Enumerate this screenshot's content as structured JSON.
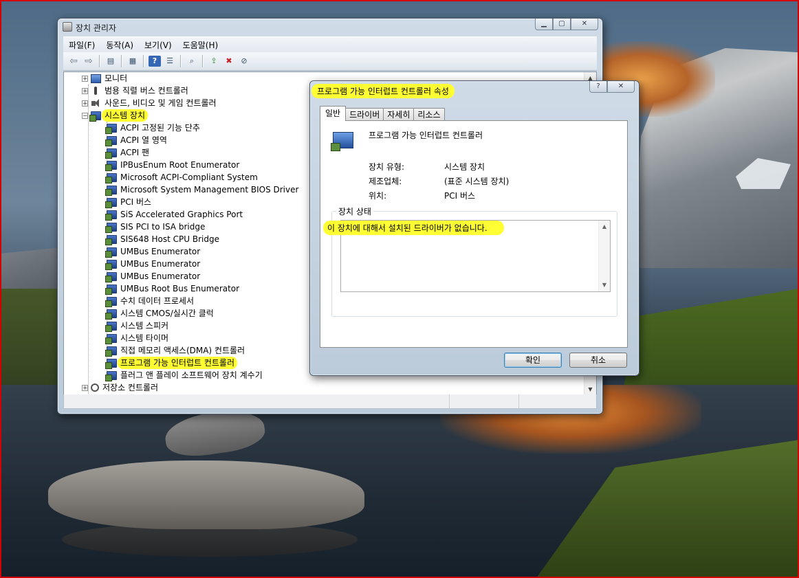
{
  "colors": {
    "highlight": "#ffff33",
    "border_red": "#d40000",
    "window_frame": "#c4d3e2"
  },
  "device_manager": {
    "title": "장치 관리자",
    "menu": [
      "파일(F)",
      "동작(A)",
      "보기(V)",
      "도움말(H)"
    ],
    "toolbar_icons": [
      "back-arrow-icon",
      "forward-arrow-icon",
      "properties-icon",
      "view-icon",
      "help-icon",
      "list-icon",
      "scan-hardware-icon",
      "update-driver-icon",
      "uninstall-icon",
      "disable-icon"
    ],
    "tree": {
      "top": [
        {
          "label": "모니터",
          "icon": "monitor-icon"
        },
        {
          "label": "범용 직렬 버스 컨트롤러",
          "icon": "usb-icon"
        },
        {
          "label": "사운드, 비디오 및 게임 컨트롤러",
          "icon": "sound-icon"
        }
      ],
      "system_devices": {
        "label": "시스템 장치",
        "expanded": true,
        "children": [
          "ACPI 고정된 기능 단추",
          "ACPI 열 영역",
          "ACPI 팬",
          "IPBusEnum Root Enumerator",
          "Microsoft ACPI-Compliant System",
          "Microsoft System Management BIOS Driver",
          "PCI 버스",
          "SiS Accelerated Graphics Port",
          "SIS PCI to ISA bridge",
          "SIS648  Host CPU Bridge",
          "UMBus Enumerator",
          "UMBus Enumerator",
          "UMBus Enumerator",
          "UMBus Root Bus Enumerator",
          "수치 데이터 프로세서",
          "시스템 CMOS/실시간 클럭",
          "시스템 스피커",
          "시스템 타이머",
          "직접 메모리 액세스(DMA) 컨트롤러",
          "프로그램 가능 인터럽트 컨트롤러",
          "플러그 앤 플레이 소프트웨어 장치 계수기"
        ],
        "selected": "프로그램 가능 인터럽트 컨트롤러"
      },
      "bottom": [
        {
          "label": "저장소 컨트롤러",
          "icon": "storage-icon"
        }
      ]
    }
  },
  "properties_dialog": {
    "title": "프로그램 가능 인터럽트 컨트롤러 속성",
    "help_glyph": "?",
    "tabs": [
      "일반",
      "드라이버",
      "자세히",
      "리소스"
    ],
    "active_tab": "일반",
    "device_name": "프로그램 가능 인터럽트 컨트롤러",
    "properties": [
      {
        "label": "장치 유형:",
        "value": "시스템 장치"
      },
      {
        "label": "제조업체:",
        "value": "(표준 시스템 장치)"
      },
      {
        "label": "위치:",
        "value": "PCI 버스"
      }
    ],
    "status_group_title": "장치 상태",
    "status_text": "이 장치에 대해서 설치된 드라이버가 없습니다.",
    "ok_label": "확인",
    "cancel_label": "취소"
  }
}
